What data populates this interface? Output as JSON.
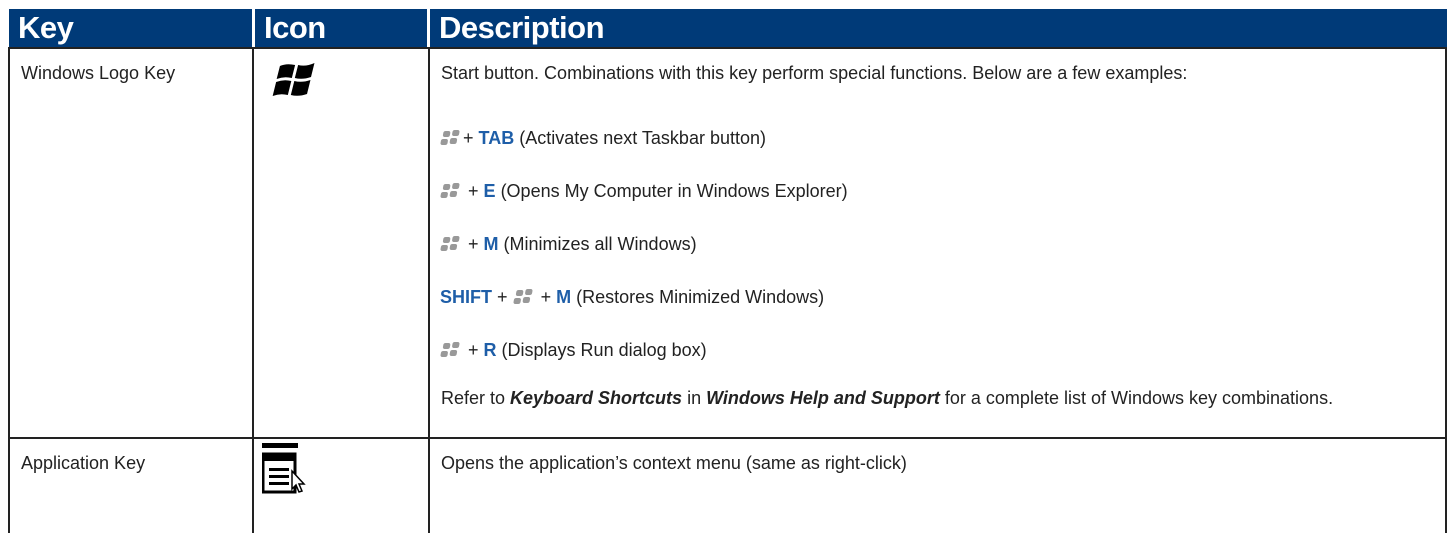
{
  "header": {
    "key": "Key",
    "icon": "Icon",
    "description": "Description"
  },
  "rows": [
    {
      "key": "Windows Logo Key",
      "icon": "windows-logo-icon",
      "description_intro": "Start button. Combinations with this key perform special functions. Below are a few examples:",
      "combos": [
        {
          "prefix": "",
          "keys": [
            "TAB"
          ],
          "text": " (Activates next Taskbar button)"
        },
        {
          "prefix": "",
          "keys": [
            "E"
          ],
          "text": " (Opens My Computer in Windows Explorer)"
        },
        {
          "prefix": "",
          "keys": [
            "M"
          ],
          "text": " (Minimizes all Windows)"
        },
        {
          "prefix": "SHIFT",
          "keys": [
            "M"
          ],
          "text": " (Restores Minimized Windows)"
        },
        {
          "prefix": "",
          "keys": [
            "R"
          ],
          "text": " (Displays Run dialog box)"
        }
      ],
      "refer_pre": "Refer to ",
      "refer_em1": "Keyboard Shortcuts",
      "refer_mid": " in ",
      "refer_em2": "Windows Help and Support",
      "refer_post": " for a complete list of Windows key combinations."
    },
    {
      "key": "Application Key",
      "icon": "application-key-icon",
      "description": "Opens the application’s context menu (same as right-click)"
    }
  ],
  "plus": "+",
  "colors": {
    "header_bg": "#003a78",
    "header_text": "#ffffff",
    "key_text": "#1e5ea8",
    "grid": "#222222"
  }
}
